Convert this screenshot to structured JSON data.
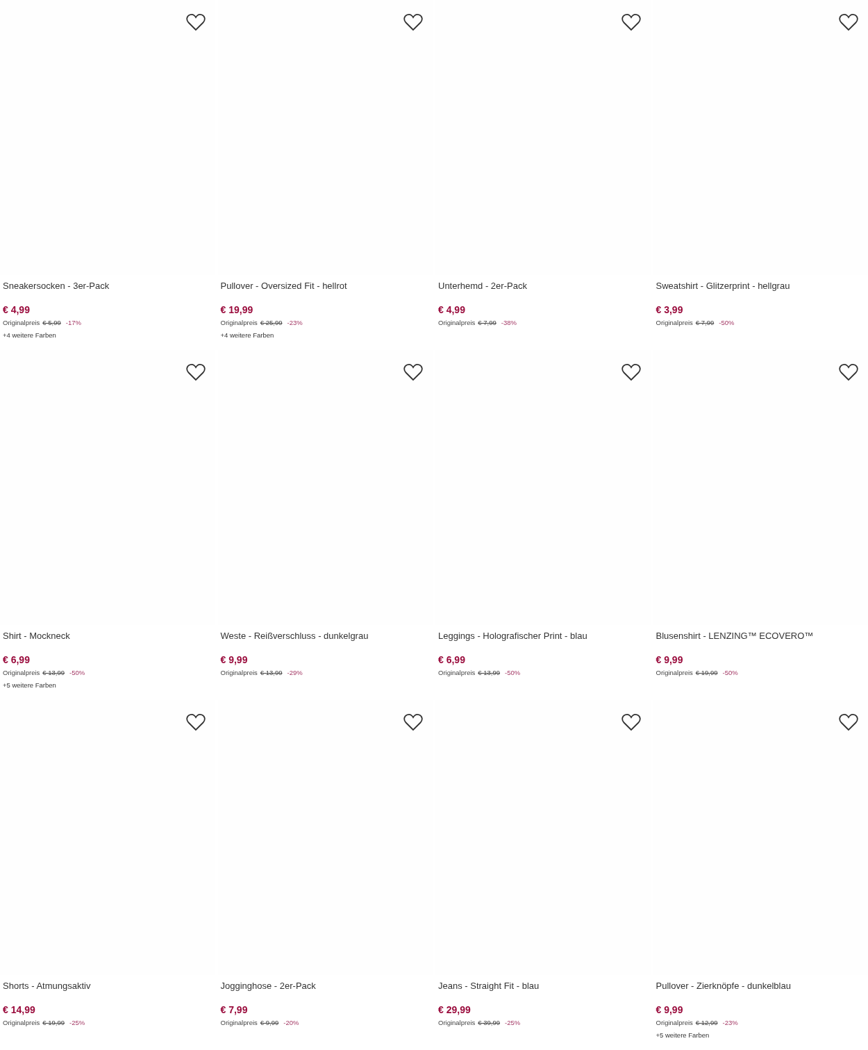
{
  "products": [
    {
      "title": "Sneakersocken - 3er-Pack",
      "price": "€ 4,99",
      "original_label": "Originalpreis",
      "original_price": "€ 5,99",
      "discount": "-17%",
      "more_colors": "+4 weitere Farben",
      "favorite": false
    },
    {
      "title": "Pullover - Oversized Fit - hellrot",
      "price": "€ 19,99",
      "original_label": "Originalpreis",
      "original_price": "€ 25,99",
      "discount": "-23%",
      "more_colors": "+4 weitere Farben",
      "favorite": false
    },
    {
      "title": "Unterhemd - 2er-Pack",
      "price": "€ 4,99",
      "original_label": "Originalpreis",
      "original_price": "€ 7,99",
      "discount": "-38%",
      "favorite": false
    },
    {
      "title": "Sweatshirt - Glitzerprint - hellgrau",
      "price": "€ 3,99",
      "original_label": "Originalpreis",
      "original_price": "€ 7,99",
      "discount": "-50%",
      "favorite": false
    },
    {
      "title": "Shirt - Mockneck",
      "price": "€ 6,99",
      "original_label": "Originalpreis",
      "original_price": "€ 13,99",
      "discount": "-50%",
      "more_colors": "+5 weitere Farben",
      "favorite": false
    },
    {
      "title": "Weste - Reißverschluss - dunkelgrau",
      "price": "€ 9,99",
      "original_label": "Originalpreis",
      "original_price": "€ 13,99",
      "discount": "-29%",
      "favorite": false
    },
    {
      "title": "Leggings - Holografischer Print - blau",
      "price": "€ 6,99",
      "original_label": "Originalpreis",
      "original_price": "€ 13,99",
      "discount": "-50%",
      "favorite": false
    },
    {
      "title": "Blusenshirt - LENZING™ ECOVERO™",
      "price": "€ 9,99",
      "original_label": "Originalpreis",
      "original_price": "€ 19,99",
      "discount": "-50%",
      "favorite": false
    },
    {
      "title": "Shorts - Atmungsaktiv",
      "price": "€ 14,99",
      "original_label": "Originalpreis",
      "original_price": "€ 19,99",
      "discount": "-25%",
      "favorite": false
    },
    {
      "title": "Jogginghose - 2er-Pack",
      "price": "€ 7,99",
      "original_label": "Originalpreis",
      "original_price": "€ 9,99",
      "discount": "-20%",
      "favorite": false
    },
    {
      "title": "Jeans - Straight Fit - blau",
      "price": "€ 29,99",
      "original_label": "Originalpreis",
      "original_price": "€ 39,99",
      "discount": "-25%",
      "favorite": false
    },
    {
      "title": "Pullover - Zierknöpfe - dunkelblau",
      "price": "€ 9,99",
      "original_label": "Originalpreis",
      "original_price": "€ 12,99",
      "discount": "-23%",
      "more_colors": "+5 weitere Farben",
      "favorite": false
    }
  ]
}
